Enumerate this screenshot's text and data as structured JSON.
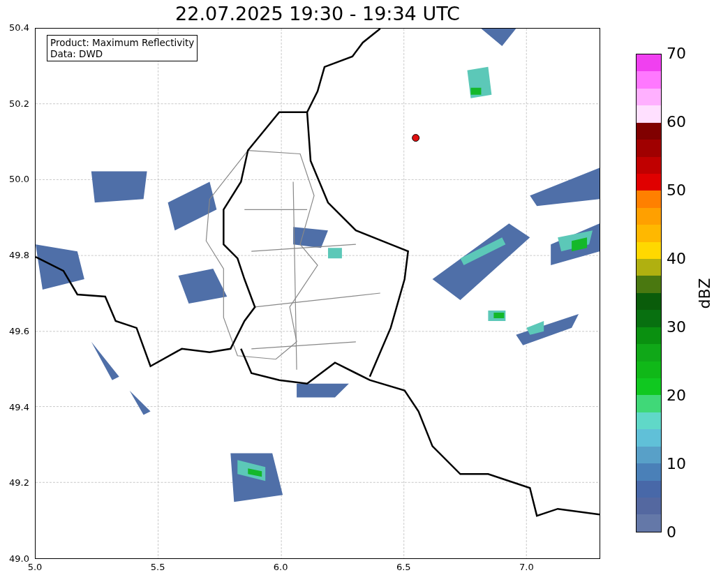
{
  "title": "22.07.2025 19:30 - 19:34 UTC",
  "map": {
    "info": [
      "Product: Maximum Reflectivity",
      "Data: DWD"
    ],
    "yticks": [
      "50.4",
      "50.2",
      "50.0",
      "49.8",
      "49.6",
      "49.4",
      "49.2",
      "49.0"
    ],
    "xticks": [
      "5.0",
      "5.5",
      "6.0",
      "6.5",
      "7.0"
    ]
  },
  "colorbar": {
    "label": "dBZ",
    "ticks": [
      "70",
      "60",
      "50",
      "40",
      "30",
      "20",
      "10",
      "0"
    ],
    "segments": [
      {
        "color": "#f040f0"
      },
      {
        "color": "#ff78ff"
      },
      {
        "color": "#ffb0ff"
      },
      {
        "color": "#ffe0ff"
      },
      {
        "color": "#800000"
      },
      {
        "color": "#a00000"
      },
      {
        "color": "#c00000"
      },
      {
        "color": "#e00000"
      },
      {
        "color": "#ff8000"
      },
      {
        "color": "#ffa000"
      },
      {
        "color": "#ffb800"
      },
      {
        "color": "#ffd800"
      },
      {
        "color": "#b0b010"
      },
      {
        "color": "#4a7810"
      },
      {
        "color": "#0a5c0a"
      },
      {
        "color": "#087010"
      },
      {
        "color": "#0a9010"
      },
      {
        "color": "#10a818"
      },
      {
        "color": "#10b818"
      },
      {
        "color": "#10c820"
      },
      {
        "color": "#40d878"
      },
      {
        "color": "#60d8c8"
      },
      {
        "color": "#60c0d8"
      },
      {
        "color": "#58a0c8"
      },
      {
        "color": "#4a80b8"
      },
      {
        "color": "#4868a8"
      },
      {
        "color": "#5468a0"
      },
      {
        "color": "#6478a8"
      }
    ]
  }
}
